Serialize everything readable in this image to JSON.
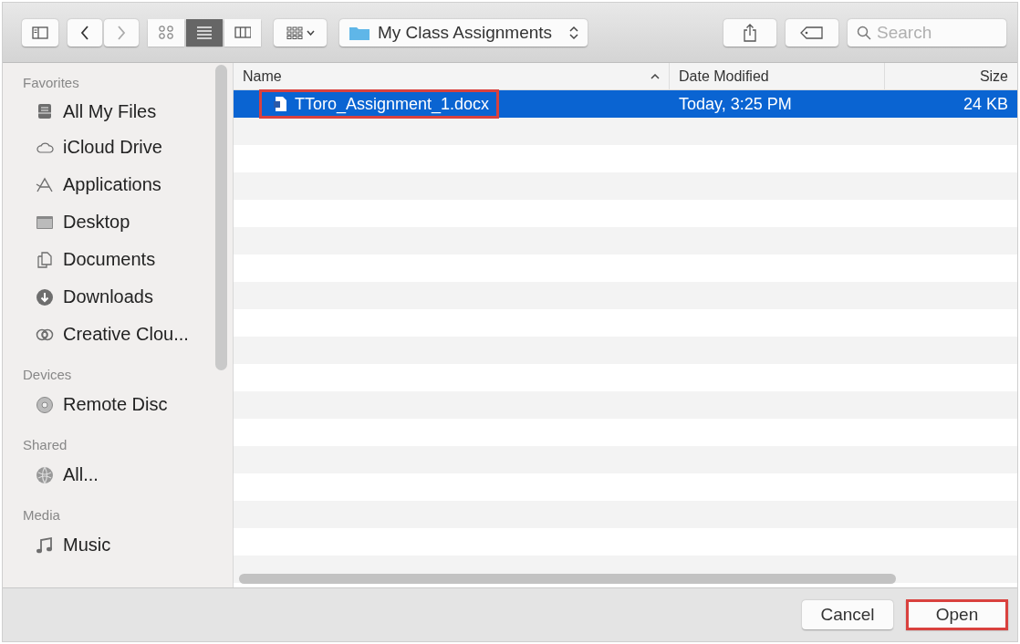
{
  "toolbar": {
    "view_modes": [
      {
        "kind": "icons",
        "selected": false
      },
      {
        "kind": "list",
        "selected": true
      },
      {
        "kind": "columns",
        "selected": false
      }
    ],
    "location": "My Class Assignments",
    "search": {
      "placeholder": "Search"
    }
  },
  "sidebar": {
    "sections": [
      {
        "title": "Favorites",
        "items": [
          {
            "label": "All My Files",
            "kind": "files"
          },
          {
            "label": "iCloud Drive",
            "kind": "cloud"
          },
          {
            "label": "Applications",
            "kind": "apps"
          },
          {
            "label": "Desktop",
            "kind": "desktop"
          },
          {
            "label": "Documents",
            "kind": "documents"
          },
          {
            "label": "Downloads",
            "kind": "downloads"
          },
          {
            "label": "Creative Clou...",
            "kind": "creative"
          }
        ]
      },
      {
        "title": "Devices",
        "items": [
          {
            "label": "Remote Disc",
            "kind": "disc"
          }
        ]
      },
      {
        "title": "Shared",
        "items": [
          {
            "label": "All...",
            "kind": "network"
          }
        ]
      },
      {
        "title": "Media",
        "items": [
          {
            "label": "Music",
            "kind": "music"
          }
        ]
      }
    ]
  },
  "table": {
    "columns": [
      {
        "label": "Name",
        "sorted": true
      },
      {
        "label": "Date Modified",
        "sorted": false
      },
      {
        "label": "Size",
        "sorted": false
      }
    ],
    "rows": [
      {
        "name": "TToro_Assignment_1.docx",
        "date": "Today, 3:25 PM",
        "size": "24 KB",
        "selected": true,
        "highlighted": true
      }
    ]
  },
  "buttons": [
    {
      "label": "Cancel",
      "highlighted": false
    },
    {
      "label": "Open",
      "highlighted": true
    }
  ]
}
